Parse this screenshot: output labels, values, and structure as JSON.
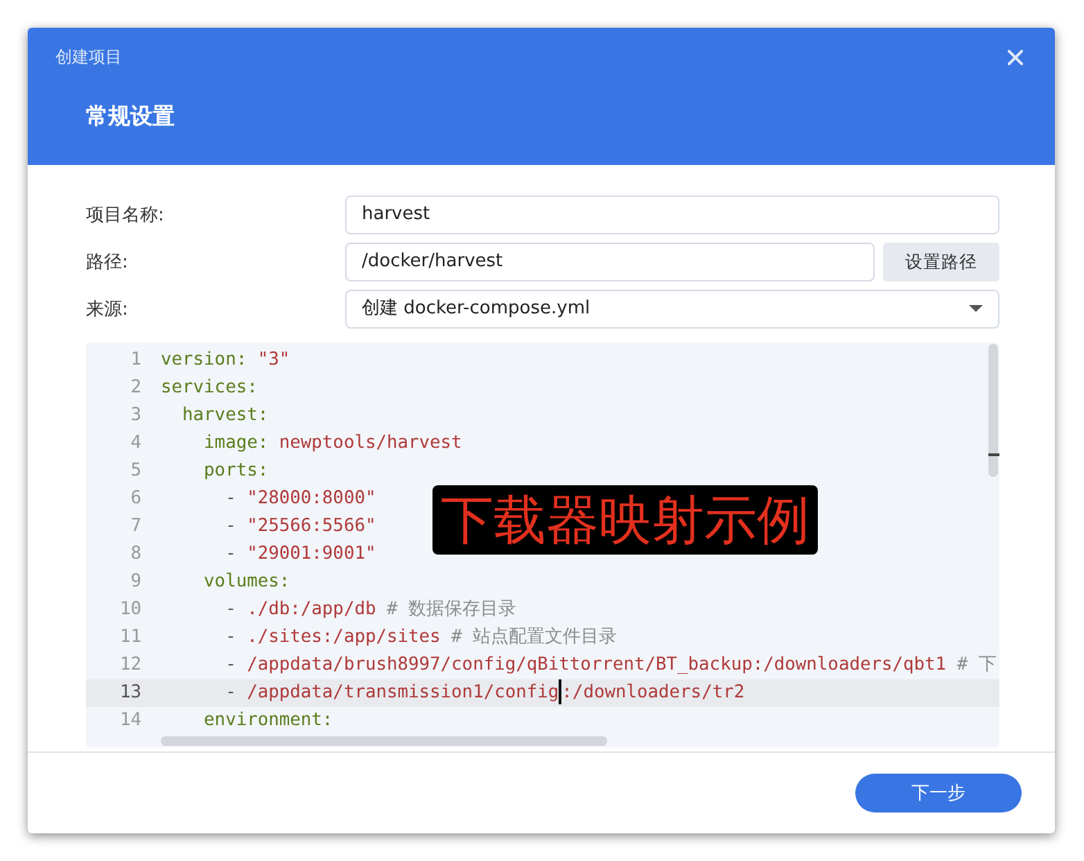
{
  "dialog": {
    "title": "创建项目",
    "heading": "常规设置"
  },
  "form": [
    {
      "kind": "text",
      "label": "项目名称:",
      "value": "harvest"
    },
    {
      "kind": "path",
      "label": "路径:",
      "value": "/docker/harvest",
      "button": "设置路径"
    },
    {
      "kind": "select",
      "label": "来源:",
      "value": "创建 docker-compose.yml"
    }
  ],
  "editor": {
    "lines": [
      {
        "number": "1",
        "current": false,
        "tokens": [
          {
            "kind": "key",
            "text": "version: "
          },
          {
            "kind": "string",
            "text": "\"3\""
          }
        ]
      },
      {
        "number": "2",
        "current": false,
        "tokens": [
          {
            "kind": "key",
            "text": "services:"
          }
        ]
      },
      {
        "number": "3",
        "current": false,
        "tokens": [
          {
            "kind": "key",
            "text": "  harvest:"
          }
        ]
      },
      {
        "number": "4",
        "current": false,
        "tokens": [
          {
            "kind": "key",
            "text": "    image: "
          },
          {
            "kind": "string",
            "text": "newptools/harvest"
          }
        ]
      },
      {
        "number": "5",
        "current": false,
        "tokens": [
          {
            "kind": "key",
            "text": "    ports:"
          }
        ]
      },
      {
        "number": "6",
        "current": false,
        "tokens": [
          {
            "kind": "punct",
            "text": "      - "
          },
          {
            "kind": "string",
            "text": "\"28000:8000\""
          }
        ]
      },
      {
        "number": "7",
        "current": false,
        "tokens": [
          {
            "kind": "punct",
            "text": "      - "
          },
          {
            "kind": "string",
            "text": "\"25566:5566\""
          }
        ]
      },
      {
        "number": "8",
        "current": false,
        "tokens": [
          {
            "kind": "punct",
            "text": "      - "
          },
          {
            "kind": "string",
            "text": "\"29001:9001\""
          }
        ]
      },
      {
        "number": "9",
        "current": false,
        "tokens": [
          {
            "kind": "key",
            "text": "    volumes:"
          }
        ]
      },
      {
        "number": "10",
        "current": false,
        "tokens": [
          {
            "kind": "punct",
            "text": "      - "
          },
          {
            "kind": "string",
            "text": "./db:/app/db"
          },
          {
            "kind": "comment",
            "text": " # 数据保存目录"
          }
        ]
      },
      {
        "number": "11",
        "current": false,
        "tokens": [
          {
            "kind": "punct",
            "text": "      - "
          },
          {
            "kind": "string",
            "text": "./sites:/app/sites"
          },
          {
            "kind": "comment",
            "text": " # 站点配置文件目录"
          }
        ]
      },
      {
        "number": "12",
        "current": false,
        "tokens": [
          {
            "kind": "punct",
            "text": "      - "
          },
          {
            "kind": "string",
            "text": "/appdata/brush8997/config/qBittorrent/BT_backup:/downloaders/qbt1"
          },
          {
            "kind": "comment",
            "text": " # 下"
          }
        ]
      },
      {
        "number": "13",
        "current": true,
        "tokens": [
          {
            "kind": "punct",
            "text": "      - "
          },
          {
            "kind": "string",
            "text": "/appdata/transmission1/config",
            "cursor": true
          },
          {
            "kind": "string",
            "text": ":/downloaders/tr2"
          }
        ]
      },
      {
        "number": "14",
        "current": false,
        "tokens": [
          {
            "kind": "key",
            "text": "    environment:"
          }
        ]
      }
    ]
  },
  "annotation": "下载器映射示例",
  "buttons": [
    {
      "label": "下一步",
      "kind": "primary"
    }
  ]
}
